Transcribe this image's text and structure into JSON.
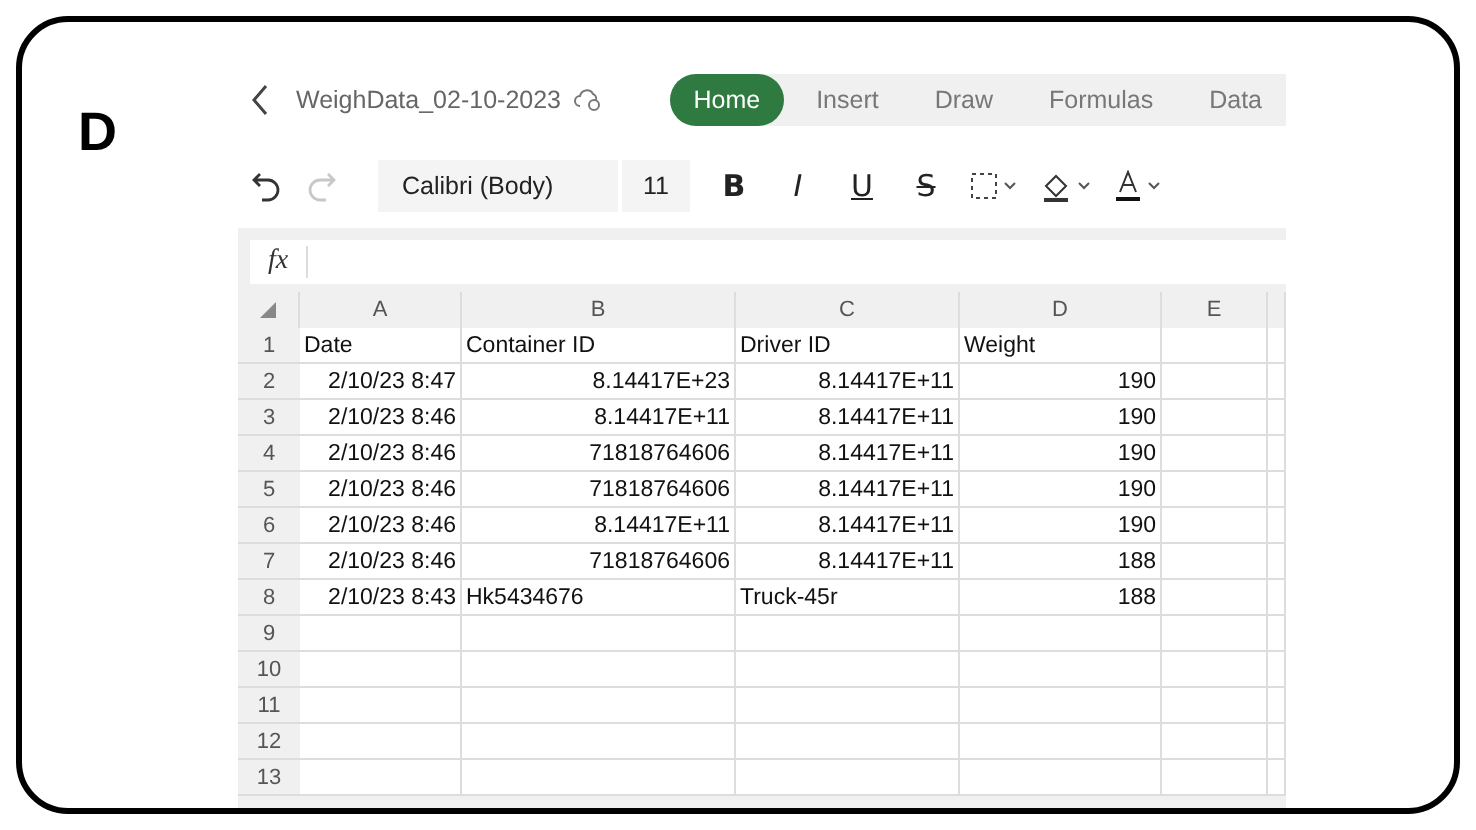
{
  "panel_label": "D",
  "header": {
    "file_name": "WeighData_02-10-2023",
    "tabs": [
      {
        "label": "Home",
        "selected": true
      },
      {
        "label": "Insert",
        "selected": false
      },
      {
        "label": "Draw",
        "selected": false
      },
      {
        "label": "Formulas",
        "selected": false
      },
      {
        "label": "Data",
        "selected": false
      }
    ]
  },
  "toolbar": {
    "redo_disabled": true,
    "font": "Calibri (Body)",
    "size": "11",
    "bold": "B",
    "italic": "I",
    "underline": "U",
    "strike": "S"
  },
  "formula_bar": {
    "label": "fx"
  },
  "grid": {
    "columns": [
      "A",
      "B",
      "C",
      "D",
      "E"
    ],
    "rows": [
      {
        "label": "1",
        "cells": [
          {
            "text": "Date",
            "kind": "text"
          },
          {
            "text": "Container ID",
            "kind": "text"
          },
          {
            "text": "Driver ID",
            "kind": "text"
          },
          {
            "text": "Weight",
            "kind": "text"
          }
        ]
      },
      {
        "label": "2",
        "cells": [
          {
            "text": "2/10/23 8:47",
            "kind": "number"
          },
          {
            "text": "8.14417E+23",
            "kind": "number"
          },
          {
            "text": "8.14417E+11",
            "kind": "number"
          },
          {
            "text": "190",
            "kind": "number"
          }
        ]
      },
      {
        "label": "3",
        "cells": [
          {
            "text": "2/10/23 8:46",
            "kind": "number"
          },
          {
            "text": "8.14417E+11",
            "kind": "number"
          },
          {
            "text": "8.14417E+11",
            "kind": "number"
          },
          {
            "text": "190",
            "kind": "number"
          }
        ]
      },
      {
        "label": "4",
        "cells": [
          {
            "text": "2/10/23 8:46",
            "kind": "number"
          },
          {
            "text": "71818764606",
            "kind": "number"
          },
          {
            "text": "8.14417E+11",
            "kind": "number"
          },
          {
            "text": "190",
            "kind": "number"
          }
        ]
      },
      {
        "label": "5",
        "cells": [
          {
            "text": "2/10/23 8:46",
            "kind": "number"
          },
          {
            "text": "71818764606",
            "kind": "number"
          },
          {
            "text": "8.14417E+11",
            "kind": "number"
          },
          {
            "text": "190",
            "kind": "number"
          }
        ]
      },
      {
        "label": "6",
        "cells": [
          {
            "text": "2/10/23 8:46",
            "kind": "number"
          },
          {
            "text": "8.14417E+11",
            "kind": "number"
          },
          {
            "text": "8.14417E+11",
            "kind": "number"
          },
          {
            "text": "190",
            "kind": "number"
          }
        ]
      },
      {
        "label": "7",
        "cells": [
          {
            "text": "2/10/23 8:46",
            "kind": "number"
          },
          {
            "text": "71818764606",
            "kind": "number"
          },
          {
            "text": "8.14417E+11",
            "kind": "number"
          },
          {
            "text": "188",
            "kind": "number"
          }
        ]
      },
      {
        "label": "8",
        "cells": [
          {
            "text": "2/10/23 8:43",
            "kind": "number"
          },
          {
            "text": "Hk5434676",
            "kind": "text"
          },
          {
            "text": "Truck-45r",
            "kind": "text"
          },
          {
            "text": "188",
            "kind": "number"
          }
        ]
      },
      {
        "label": "9",
        "cells": []
      },
      {
        "label": "10",
        "cells": []
      },
      {
        "label": "11",
        "cells": []
      },
      {
        "label": "12",
        "cells": []
      },
      {
        "label": "13",
        "cells": []
      }
    ]
  }
}
